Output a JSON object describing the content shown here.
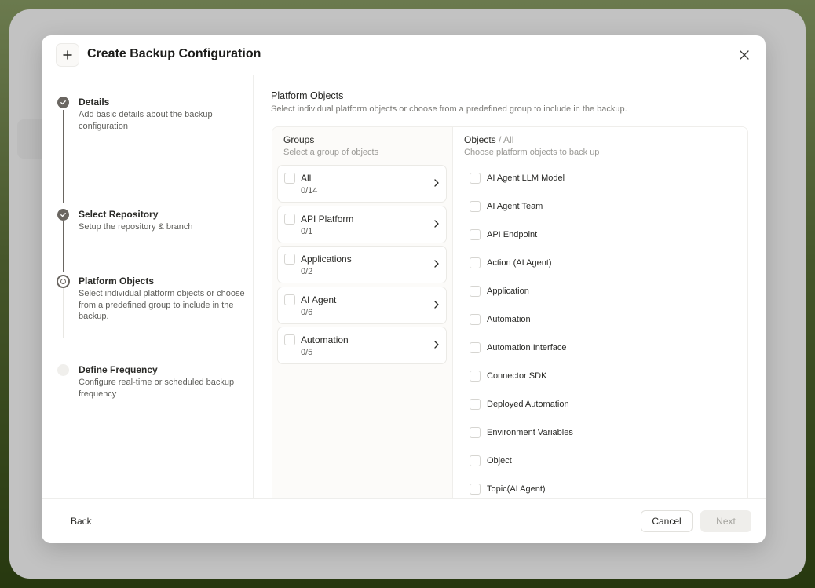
{
  "modal": {
    "title": "Create Backup Configuration"
  },
  "steps": [
    {
      "title": "Details",
      "description": "Add basic details about the backup configuration",
      "status": "done"
    },
    {
      "title": "Select Repository",
      "description": "Setup the repository & branch",
      "status": "done"
    },
    {
      "title": "Platform Objects",
      "description": "Select individual platform objects or choose from a predefined group to include in the backup.",
      "status": "current"
    },
    {
      "title": "Define Frequency",
      "description": "Configure real-time or scheduled backup frequency",
      "status": "todo"
    }
  ],
  "section": {
    "title": "Platform Objects",
    "description": "Select individual platform objects or choose from a predefined group to include in the backup."
  },
  "groups": {
    "title": "Groups",
    "description": "Select a group of objects",
    "items": [
      {
        "label": "All",
        "count": "0/14"
      },
      {
        "label": "API Platform",
        "count": "0/1"
      },
      {
        "label": "Applications",
        "count": "0/2"
      },
      {
        "label": "AI Agent",
        "count": "0/6"
      },
      {
        "label": "Automation",
        "count": "0/5"
      }
    ]
  },
  "objects": {
    "title": "Objects",
    "separator": "/",
    "filter": "All",
    "description": "Choose platform objects to back up",
    "items": [
      "AI Agent LLM Model",
      "AI Agent Team",
      "API Endpoint",
      "Action (AI Agent)",
      "Application",
      "Automation",
      "Automation Interface",
      "Connector SDK",
      "Deployed Automation",
      "Environment Variables",
      "Object",
      "Topic(AI Agent)"
    ]
  },
  "footer": {
    "back_label": "Back",
    "cancel_label": "Cancel",
    "next_label": "Next"
  },
  "colors": {
    "step_active": "#6a6661",
    "next_disabled_bg": "#efeeeb",
    "background_green": "#46562a"
  },
  "icons": {
    "header": "plus-icon",
    "close": "close-icon",
    "step_done": "check-icon",
    "group_arrow": "chevron-right-icon"
  }
}
